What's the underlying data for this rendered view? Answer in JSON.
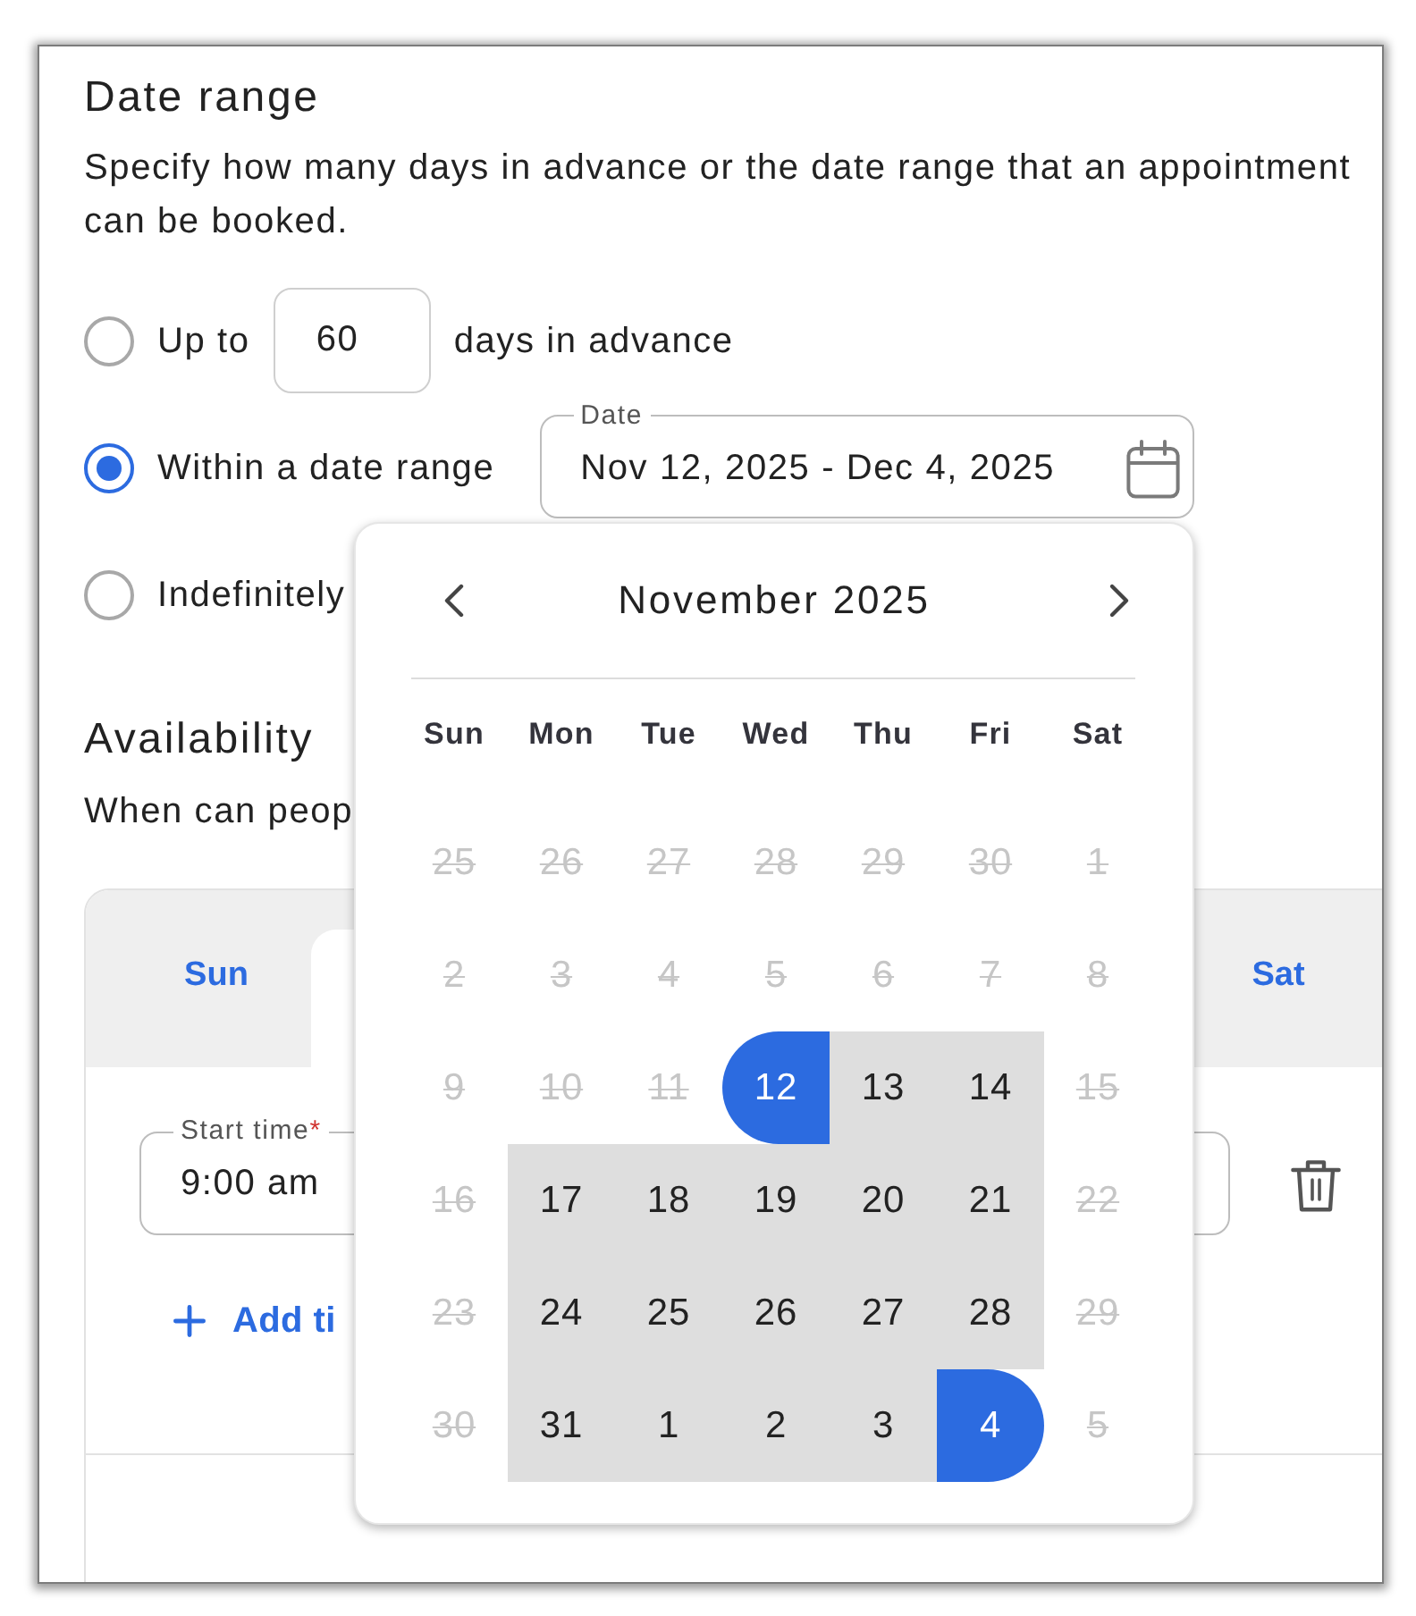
{
  "date_range": {
    "title": "Date range",
    "description": "Specify how many days in advance or the date range that an appointment can be booked.",
    "options": [
      {
        "kind": "days",
        "label": "Up to",
        "selected": false,
        "value": "60",
        "suffix": "days in advance"
      },
      {
        "kind": "date",
        "label": "Within a date range",
        "selected": true,
        "field_label": "Date",
        "value": "Nov 12, 2025 - Dec 4, 2025"
      },
      {
        "kind": "plain",
        "label": "Indefinitely",
        "selected": false
      }
    ]
  },
  "date_picker": {
    "month": "November 2025",
    "weekdays": [
      "Sun",
      "Mon",
      "Tue",
      "Wed",
      "Thu",
      "Fri",
      "Sat"
    ],
    "weeks": [
      {
        "days": [
          {
            "label": "25",
            "disabled": true,
            "in_range": false,
            "selected": false
          },
          {
            "label": "26",
            "disabled": true,
            "in_range": false,
            "selected": false
          },
          {
            "label": "27",
            "disabled": true,
            "in_range": false,
            "selected": false
          },
          {
            "label": "28",
            "disabled": true,
            "in_range": false,
            "selected": false
          },
          {
            "label": "29",
            "disabled": true,
            "in_range": false,
            "selected": false
          },
          {
            "label": "30",
            "disabled": true,
            "in_range": false,
            "selected": false
          },
          {
            "label": "1",
            "disabled": true,
            "in_range": false,
            "selected": false
          }
        ]
      },
      {
        "days": [
          {
            "label": "2",
            "disabled": true,
            "in_range": false,
            "selected": false
          },
          {
            "label": "3",
            "disabled": true,
            "in_range": false,
            "selected": false
          },
          {
            "label": "4",
            "disabled": true,
            "in_range": false,
            "selected": false
          },
          {
            "label": "5",
            "disabled": true,
            "in_range": false,
            "selected": false
          },
          {
            "label": "6",
            "disabled": true,
            "in_range": false,
            "selected": false
          },
          {
            "label": "7",
            "disabled": true,
            "in_range": false,
            "selected": false
          },
          {
            "label": "8",
            "disabled": true,
            "in_range": false,
            "selected": false
          }
        ]
      },
      {
        "days": [
          {
            "label": "9",
            "disabled": true,
            "in_range": false,
            "selected": false
          },
          {
            "label": "10",
            "disabled": true,
            "in_range": false,
            "selected": false
          },
          {
            "label": "11",
            "disabled": true,
            "in_range": false,
            "selected": false
          },
          {
            "label": "12",
            "disabled": false,
            "in_range": false,
            "selected": true
          },
          {
            "label": "13",
            "disabled": false,
            "in_range": true,
            "selected": false
          },
          {
            "label": "14",
            "disabled": false,
            "in_range": true,
            "selected": false
          },
          {
            "label": "15",
            "disabled": true,
            "in_range": false,
            "selected": false
          }
        ]
      },
      {
        "days": [
          {
            "label": "16",
            "disabled": true,
            "in_range": false,
            "selected": false
          },
          {
            "label": "17",
            "disabled": false,
            "in_range": true,
            "selected": false
          },
          {
            "label": "18",
            "disabled": false,
            "in_range": true,
            "selected": false
          },
          {
            "label": "19",
            "disabled": false,
            "in_range": true,
            "selected": false
          },
          {
            "label": "20",
            "disabled": false,
            "in_range": true,
            "selected": false
          },
          {
            "label": "21",
            "disabled": false,
            "in_range": true,
            "selected": false
          },
          {
            "label": "22",
            "disabled": true,
            "in_range": false,
            "selected": false
          }
        ]
      },
      {
        "days": [
          {
            "label": "23",
            "disabled": true,
            "in_range": false,
            "selected": false
          },
          {
            "label": "24",
            "disabled": false,
            "in_range": true,
            "selected": false
          },
          {
            "label": "25",
            "disabled": false,
            "in_range": true,
            "selected": false
          },
          {
            "label": "26",
            "disabled": false,
            "in_range": true,
            "selected": false
          },
          {
            "label": "27",
            "disabled": false,
            "in_range": true,
            "selected": false
          },
          {
            "label": "28",
            "disabled": false,
            "in_range": true,
            "selected": false
          },
          {
            "label": "29",
            "disabled": true,
            "in_range": false,
            "selected": false
          }
        ]
      },
      {
        "days": [
          {
            "label": "30",
            "disabled": true,
            "in_range": false,
            "selected": false
          },
          {
            "label": "31",
            "disabled": false,
            "in_range": true,
            "selected": false
          },
          {
            "label": "1",
            "disabled": false,
            "in_range": true,
            "selected": false
          },
          {
            "label": "2",
            "disabled": false,
            "in_range": true,
            "selected": false
          },
          {
            "label": "3",
            "disabled": false,
            "in_range": true,
            "selected": false
          },
          {
            "label": "4",
            "disabled": false,
            "in_range": false,
            "selected": true
          },
          {
            "label": "5",
            "disabled": true,
            "in_range": false,
            "selected": false
          }
        ]
      }
    ]
  },
  "availability": {
    "title": "Availability",
    "description": "When can peop",
    "tabs": [
      {
        "label": "Sun",
        "selected": false
      },
      {
        "selected": true
      },
      {
        "label": "Sat",
        "selected": false
      }
    ],
    "slots": [
      {
        "start_label": "Start time",
        "required_mark": "*",
        "start_value": "9:00 am"
      }
    ],
    "add_label": "Add ti"
  }
}
